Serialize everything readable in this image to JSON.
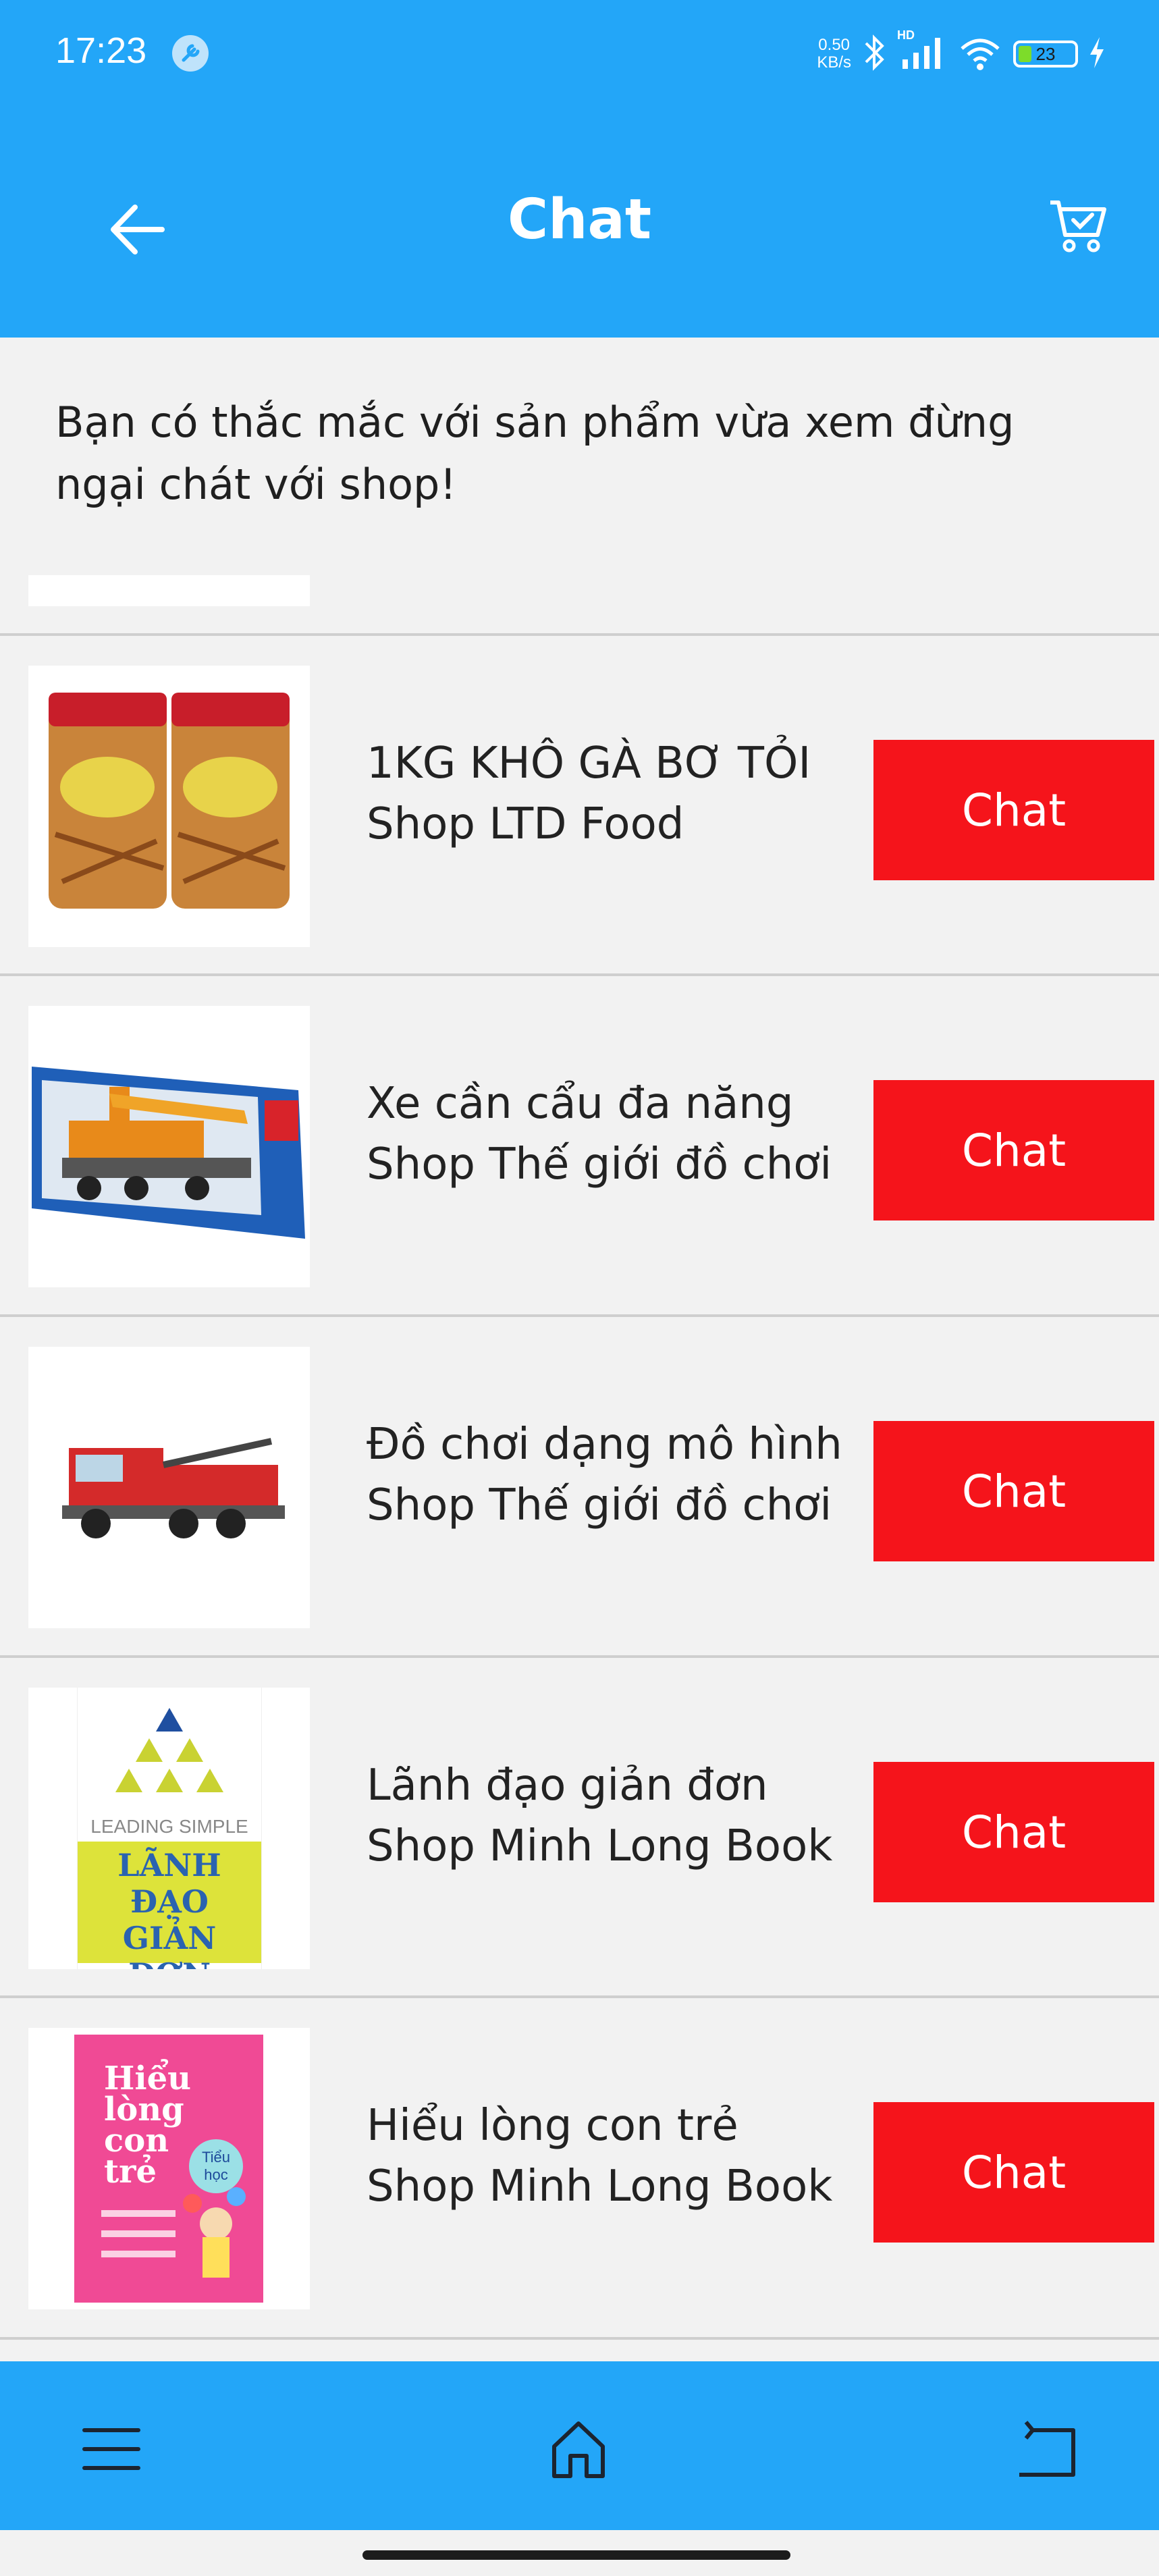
{
  "status_bar": {
    "time": "17:23",
    "net_speed_value": "0.50",
    "net_speed_unit": "KB/s",
    "network_badge": "HD",
    "battery_level": "23"
  },
  "header": {
    "title": "Chat",
    "back_icon": "arrow-left-icon",
    "cart_icon": "cart-check-icon"
  },
  "hint": "Bạn có thắc mắc với sản phẩm vừa xem đừng ngại chát với shop!",
  "products": [
    {
      "name": "1KG KHÔ GÀ BƠ TỎI",
      "shop": "Shop LTD Food",
      "action": "Chat"
    },
    {
      "name": "Xe cần cẩu đa năng",
      "shop": "Shop Thế giới đồ chơi",
      "action": "Chat"
    },
    {
      "name": "Đồ chơi dạng mô hình",
      "shop": "Shop Thế giới đồ chơi",
      "action": "Chat"
    },
    {
      "name": "Lãnh đạo giản đơn",
      "shop": "Shop Minh Long Book",
      "action": "Chat",
      "cover": {
        "top": "LEADING SIMPLE",
        "title1": "LÃNH ĐẠO",
        "title2": "GIẢN ĐƠN"
      }
    },
    {
      "name": "Hiểu lòng con trẻ",
      "shop": "Shop Minh Long Book",
      "action": "Chat",
      "cover": {
        "l1": "Hiểu",
        "l2": "lòng",
        "l3": "con",
        "l4": "trẻ",
        "badge1": "Tiểu",
        "badge2": "học"
      }
    }
  ],
  "bottom_nav": {
    "menu_icon": "menu-icon",
    "home_icon": "home-icon",
    "back_icon": "system-back-icon"
  },
  "colors": {
    "primary": "#23a6f8",
    "chat_button": "#f5141b",
    "background": "#f2f2f2"
  }
}
